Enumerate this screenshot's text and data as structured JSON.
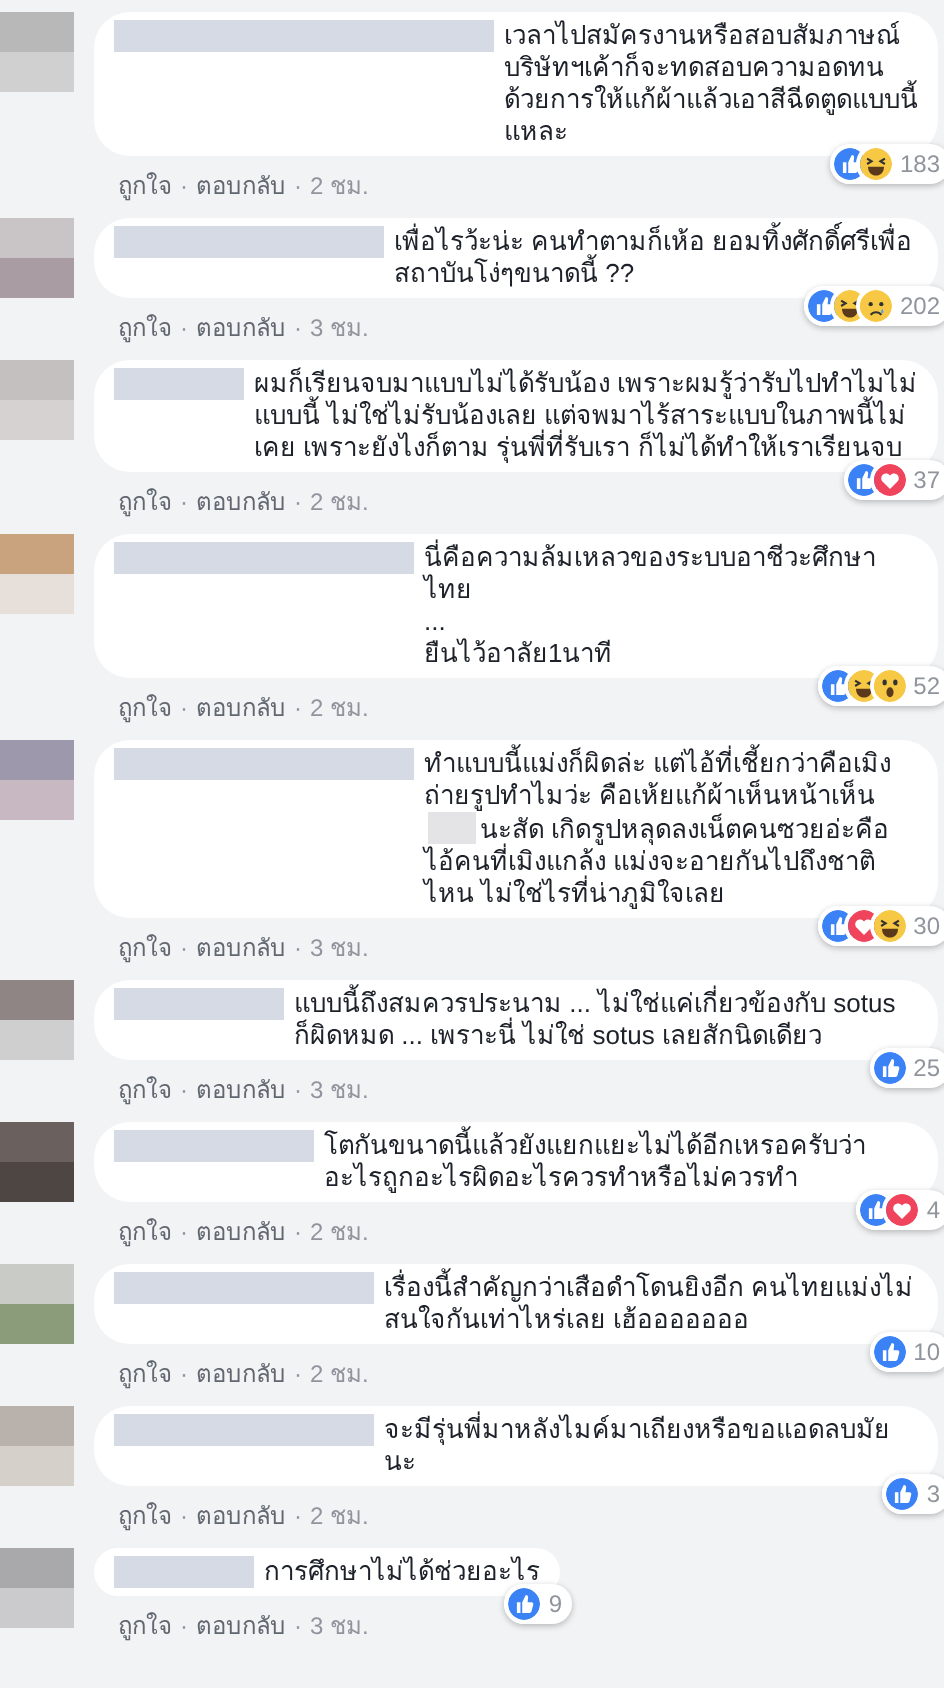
{
  "comments": [
    {
      "segments": [
        {
          "kind": "redacted_name"
        },
        {
          "kind": "text",
          "text": "เวลาไปสมัครงานหรือสอบสัมภาษณ์ บริษัทฯเค้าก็จะทดสอบความอดทนด้วยการให้แก้ผ้าแล้วเอาสีฉีดตูดแบบนี้แหละ"
        }
      ],
      "reactions": [
        {
          "kind": "like"
        },
        {
          "kind": "haha"
        }
      ],
      "reaction_count": "183",
      "actions": [
        {
          "kind": "link",
          "text": "ถูกใจ"
        },
        {
          "kind": "separator",
          "text": "·"
        },
        {
          "kind": "link",
          "text": "ตอบกลับ"
        },
        {
          "kind": "separator",
          "text": "·"
        },
        {
          "kind": "time",
          "text": "2 ชม."
        }
      ]
    },
    {
      "segments": [
        {
          "kind": "redacted_name"
        },
        {
          "kind": "text",
          "text": "เพื่อไรว้ะน่ะ คนทำตามก็เห้อ ยอมทิ้งศักดิ์ศรีเพื่อสถาบันโง่ๆขนาดนี้ ??"
        }
      ],
      "reactions": [
        {
          "kind": "like"
        },
        {
          "kind": "haha"
        },
        {
          "kind": "sad"
        }
      ],
      "reaction_count": "202",
      "actions": [
        {
          "kind": "link",
          "text": "ถูกใจ"
        },
        {
          "kind": "separator",
          "text": "·"
        },
        {
          "kind": "link",
          "text": "ตอบกลับ"
        },
        {
          "kind": "separator",
          "text": "·"
        },
        {
          "kind": "time",
          "text": "3 ชม."
        }
      ]
    },
    {
      "segments": [
        {
          "kind": "redacted_name"
        },
        {
          "kind": "text",
          "text": "ผมก็เรียนจบมาแบบไม่ได้รับน้อง เพราะผมรู้ว่ารับไปทำไมไม่แบบนี้ ไม่ใช่ไม่รับน้องเลย แต่จพมาไร้สาระแบบในภาพนี้ไม่เคย เพราะยังไงก็ตาม รุ่นพี่ที่รับเรา ก็ไม่ได้ทำให้เราเรียนจบ"
        }
      ],
      "reactions": [
        {
          "kind": "like"
        },
        {
          "kind": "love"
        }
      ],
      "reaction_count": "37",
      "actions": [
        {
          "kind": "link",
          "text": "ถูกใจ"
        },
        {
          "kind": "separator",
          "text": "·"
        },
        {
          "kind": "link",
          "text": "ตอบกลับ"
        },
        {
          "kind": "separator",
          "text": "·"
        },
        {
          "kind": "time",
          "text": "2 ชม."
        }
      ]
    },
    {
      "segments": [
        {
          "kind": "redacted_name"
        },
        {
          "kind": "text",
          "text": "นี่คือความล้มเหลวของระบบอาชีวะศึกษาไทย\n...\nยืนไว้อาลัย1นาที"
        }
      ],
      "reactions": [
        {
          "kind": "like"
        },
        {
          "kind": "haha"
        },
        {
          "kind": "wow"
        }
      ],
      "reaction_count": "52",
      "actions": [
        {
          "kind": "link",
          "text": "ถูกใจ"
        },
        {
          "kind": "separator",
          "text": "·"
        },
        {
          "kind": "link",
          "text": "ตอบกลับ"
        },
        {
          "kind": "separator",
          "text": "·"
        },
        {
          "kind": "time",
          "text": "2 ชม."
        }
      ]
    },
    {
      "segments": [
        {
          "kind": "redacted_name"
        },
        {
          "kind": "text",
          "text": "ทำแบบนี้แม่งก็ผิดล่ะ แต่ไอ้ที่เชี้ยกว่าคือเมิงถ่ายรูปทำไมว่ะ คือเห้ยแก้ผ้าเห็นหน้าเห็น"
        },
        {
          "kind": "redacted_word"
        },
        {
          "kind": "text",
          "text": "นะสัด เกิดรูปหลุดลงเน็ตคนซวยอ่ะคือไอ้คนที่เมิงแกล้ง แม่งจะอายกันไปถึงชาติไหน ไม่ใช่ไรที่น่าภูมิใจเลย"
        }
      ],
      "reactions": [
        {
          "kind": "like"
        },
        {
          "kind": "love"
        },
        {
          "kind": "haha"
        }
      ],
      "reaction_count": "30",
      "actions": [
        {
          "kind": "link",
          "text": "ถูกใจ"
        },
        {
          "kind": "separator",
          "text": "·"
        },
        {
          "kind": "link",
          "text": "ตอบกลับ"
        },
        {
          "kind": "separator",
          "text": "·"
        },
        {
          "kind": "time",
          "text": "3 ชม."
        }
      ]
    },
    {
      "segments": [
        {
          "kind": "redacted_name"
        },
        {
          "kind": "text",
          "text": "แบบนี้ถึงสมควรประนาม ... ไม่ใช่แค่เกี่ยวข้องกับ sotus ก็ผิดหมด ... เพราะนี่ ไม่ใช่ sotus เลยสักนิดเดียว"
        }
      ],
      "reactions": [
        {
          "kind": "like"
        }
      ],
      "reaction_count": "25",
      "actions": [
        {
          "kind": "link",
          "text": "ถูกใจ"
        },
        {
          "kind": "separator",
          "text": "·"
        },
        {
          "kind": "link",
          "text": "ตอบกลับ"
        },
        {
          "kind": "separator",
          "text": "·"
        },
        {
          "kind": "time",
          "text": "3 ชม."
        }
      ]
    },
    {
      "segments": [
        {
          "kind": "redacted_name"
        },
        {
          "kind": "text",
          "text": "โตกันขนาดนี้แล้วยังแยกแยะไม่ได้อีกเหรอครับว่าอะไรถูกอะไรผิดอะไรควรทำหรือไม่ควรทำ"
        }
      ],
      "reactions": [
        {
          "kind": "like"
        },
        {
          "kind": "love"
        }
      ],
      "reaction_count": "4",
      "actions": [
        {
          "kind": "link",
          "text": "ถูกใจ"
        },
        {
          "kind": "separator",
          "text": "·"
        },
        {
          "kind": "link",
          "text": "ตอบกลับ"
        },
        {
          "kind": "separator",
          "text": "·"
        },
        {
          "kind": "time",
          "text": "2 ชม."
        }
      ]
    },
    {
      "segments": [
        {
          "kind": "redacted_name"
        },
        {
          "kind": "text",
          "text": "เรื่องนี้สำคัญกว่าเสือดำโดนยิงอีก คนไทยแม่งไม่สนใจกันเท่าไหร่เลย เฮ้อออออออ"
        }
      ],
      "reactions": [
        {
          "kind": "like"
        }
      ],
      "reaction_count": "10",
      "actions": [
        {
          "kind": "link",
          "text": "ถูกใจ"
        },
        {
          "kind": "separator",
          "text": "·"
        },
        {
          "kind": "link",
          "text": "ตอบกลับ"
        },
        {
          "kind": "separator",
          "text": "·"
        },
        {
          "kind": "time",
          "text": "2 ชม."
        }
      ]
    },
    {
      "segments": [
        {
          "kind": "redacted_name"
        },
        {
          "kind": "text",
          "text": "จะมีรุ่นพี่มาหลังไมค์มาเถียงหรือขอแอดลบมัยนะ"
        }
      ],
      "reactions": [
        {
          "kind": "like"
        }
      ],
      "reaction_count": "3",
      "actions": [
        {
          "kind": "link",
          "text": "ถูกใจ"
        },
        {
          "kind": "separator",
          "text": "·"
        },
        {
          "kind": "link",
          "text": "ตอบกลับ"
        },
        {
          "kind": "separator",
          "text": "·"
        },
        {
          "kind": "time",
          "text": "2 ชม."
        }
      ]
    },
    {
      "segments": [
        {
          "kind": "redacted_name"
        },
        {
          "kind": "text",
          "text": "การศึกษาไม่ได้ช่วยอะไร"
        }
      ],
      "reactions": [
        {
          "kind": "like"
        }
      ],
      "reaction_count": "9",
      "actions": [
        {
          "kind": "link",
          "text": "ถูกใจ"
        },
        {
          "kind": "separator",
          "text": "·"
        },
        {
          "kind": "link",
          "text": "ตอบกลับ"
        },
        {
          "kind": "separator",
          "text": "·"
        },
        {
          "kind": "time",
          "text": "3 ชม."
        }
      ]
    }
  ]
}
